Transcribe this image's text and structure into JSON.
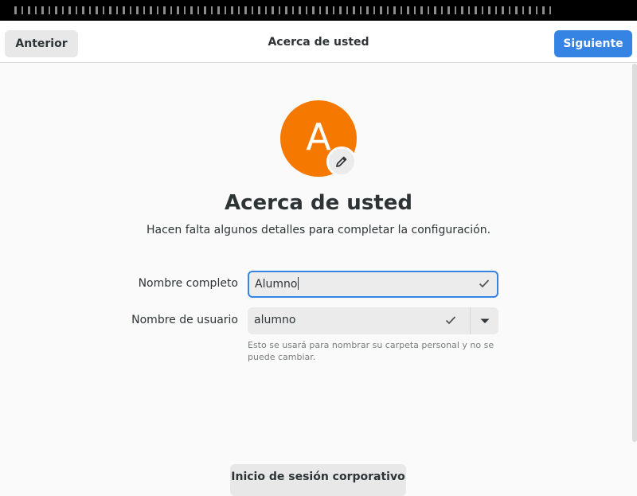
{
  "header": {
    "back_label": "Anterior",
    "title": "Acerca de usted",
    "next_label": "Siguiente"
  },
  "avatar": {
    "letter": "A",
    "color": "#f57900",
    "edit_icon": "pencil-icon"
  },
  "main": {
    "title": "Acerca de usted",
    "subtitle": "Hacen falta algunos detalles para completar la configuración."
  },
  "form": {
    "full_name_label": "Nombre completo",
    "full_name_value": "Alumno",
    "username_label": "Nombre de usuario",
    "username_value": "alumno",
    "username_hint": "Esto se usará para nombrar su carpeta personal y no se puede cambiar."
  },
  "footer": {
    "enterprise_login_label": "Inicio de sesión corporativo"
  },
  "colors": {
    "accent": "#3584e4",
    "avatar_bg": "#f57900"
  }
}
